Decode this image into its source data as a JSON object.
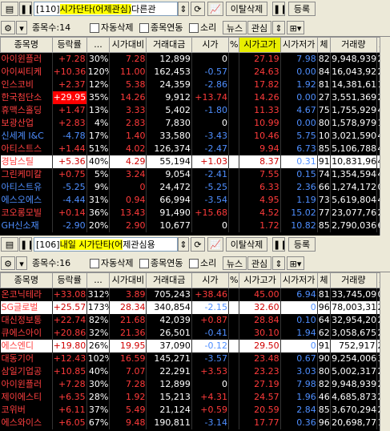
{
  "panel1": {
    "code": "[110]",
    "name_highlight": "시가단타(어제관심)",
    "name_rest": "다른관",
    "btn_remove": "이탈삭제",
    "btn_register": "등록",
    "count_label": "종목수:14",
    "chk_auto_delete": "자동삭제",
    "chk_stock_link": "종목연동",
    "chk_sound": "소리",
    "btn_news": "뉴스",
    "btn_interest": "관심",
    "headers": [
      "종목명",
      "등락률",
      "...",
      "시가대비",
      "거래대금",
      "시가",
      "%",
      "시가고가",
      "시가저가",
      "체",
      "거래량",
      "프"
    ],
    "rows": [
      [
        "아이윈플러",
        "+7.28",
        "30%",
        "7.28",
        "12,899",
        "0",
        "",
        "27.19",
        "7.98",
        "82",
        "9,948,939",
        "22"
      ],
      [
        "아이씨티케",
        "+10.36",
        "120%",
        "11.00",
        "162,453",
        "-0.57",
        "",
        "24.63",
        "0.00",
        "84",
        "16,043,928",
        "22"
      ],
      [
        "인스코비",
        "+2.37",
        "12%",
        "5.38",
        "24,359",
        "-2.86",
        "",
        "17.82",
        "1.92",
        "81",
        "14,381,613",
        "14"
      ],
      [
        "한국첨단소",
        "+29.95",
        "35%",
        "14.26",
        "9,912",
        "+13.74",
        "",
        "14.26",
        "0.00",
        "27",
        "3,551,369",
        "29"
      ],
      [
        "휴맥스홀딩",
        "+1.47",
        "13%",
        "3.33",
        "5,402",
        "-1.80",
        "",
        "11.33",
        "4.67",
        "75",
        "1,755,929",
        "49"
      ],
      [
        "보광산업",
        "+2.83",
        "4%",
        "2.83",
        "7,830",
        "0",
        "",
        "10.99",
        "0.00",
        "80",
        "1,578,979",
        "10"
      ],
      [
        "신세계 I&C",
        "-4.78",
        "17%",
        "1.40",
        "33,580",
        "-3.43",
        "",
        "10.46",
        "5.75",
        "101",
        "3,021,590",
        "46"
      ],
      [
        "아티스트스",
        "+1.44",
        "51%",
        "4.02",
        "126,374",
        "-2.47",
        "",
        "9.94",
        "6.73",
        "85",
        "5,106,788",
        "47"
      ],
      [
        "경남스틸",
        "+5.36",
        "40%",
        "4.29",
        "55,194",
        "+1.03",
        "",
        "8.37",
        "0.31",
        "91",
        "10,831,967",
        "49"
      ],
      [
        "그린케미칼",
        "+0.75",
        "5%",
        "3.24",
        "9,054",
        "-2.41",
        "",
        "7.55",
        "0.15",
        "74",
        "1,354,594",
        "44"
      ],
      [
        "아티스트유",
        "-5.25",
        "9%",
        "0",
        "24,472",
        "-5.25",
        "",
        "6.33",
        "2.36",
        "66",
        "1,274,172",
        "00"
      ],
      [
        "에스오에스",
        "-4.44",
        "31%",
        "0.94",
        "66,994",
        "-3.54",
        "",
        "4.95",
        "1.19",
        "73",
        "5,619,804",
        "45"
      ],
      [
        "코오롱모빌",
        "+0.14",
        "36%",
        "13.43",
        "91,490",
        "+15.68",
        "",
        "4.52",
        "15.02",
        "77",
        "23,077,767",
        "20"
      ],
      [
        "GH신소재",
        "-2.90",
        "20%",
        "2.90",
        "10,677",
        "0",
        "",
        "1.72",
        "10.82",
        "85",
        "2,790,036",
        "62"
      ]
    ]
  },
  "panel2": {
    "code": "[106]",
    "name_highlight": "내일 시가단타(어",
    "name_rest": "제관심용",
    "btn_remove": "이탈삭제",
    "btn_register": "등록",
    "count_label": "종목수:16",
    "chk_auto_delete": "자동삭제",
    "chk_stock_link": "종목연동",
    "chk_sound": "소리",
    "btn_news": "뉴스",
    "btn_interest": "관심",
    "headers": [
      "종목명",
      "등락률",
      "...",
      "시가대비",
      "거래대금",
      "시가",
      "%",
      "시가고가",
      "시가저가",
      "체",
      "거래량",
      "프"
    ],
    "rows": [
      [
        "온코닉테라",
        "+33.08",
        "312%",
        "3.89",
        "705,243",
        "+38.46",
        "",
        "45.00",
        "6.94",
        "81",
        "33,745,097",
        "00"
      ],
      [
        "SG글로벌",
        "+25.57",
        "173%",
        "28.34",
        "340,854",
        "-2.15",
        "",
        "32.60",
        "0",
        "96",
        "78,003,311",
        "26"
      ],
      [
        "대신정보통",
        "+22.74",
        "82%",
        "21.68",
        "42,039",
        "+0.87",
        "",
        "28.84",
        "0.10",
        "64",
        "32,954,204",
        "25"
      ],
      [
        "큐에스아이",
        "+20.86",
        "32%",
        "21.36",
        "26,501",
        "-0.41",
        "",
        "30.10",
        "1.94",
        "62",
        "3,058,675",
        "29"
      ],
      [
        "에스엔디",
        "+19.80",
        "26%",
        "19.95",
        "37,090",
        "-0.12",
        "",
        "29.50",
        "0",
        "91",
        "752,917",
        "29"
      ],
      [
        "대동기어",
        "+12.43",
        "102%",
        "16.59",
        "145,271",
        "-3.57",
        "",
        "23.48",
        "0.67",
        "90",
        "9,254,006",
        "39"
      ],
      [
        "삼일기업공",
        "+10.85",
        "40%",
        "7.07",
        "22,291",
        "+3.53",
        "",
        "23.23",
        "3.03",
        "80",
        "5,002,317",
        "27"
      ],
      [
        "아이윈플러",
        "+7.28",
        "30%",
        "7.28",
        "12,899",
        "0",
        "",
        "27.19",
        "7.98",
        "82",
        "9,948,939",
        "22"
      ],
      [
        "제이에스티",
        "+6.35",
        "28%",
        "1.92",
        "15,213",
        "+4.31",
        "",
        "24.57",
        "1.96",
        "46",
        "4,685,873",
        "29"
      ],
      [
        "코위버",
        "+6.11",
        "37%",
        "5.49",
        "21,124",
        "+0.59",
        "",
        "20.59",
        "2.84",
        "85",
        "3,670,294",
        "21"
      ],
      [
        "에스와이스",
        "+6.05",
        "67%",
        "9.48",
        "190,811",
        "-3.14",
        "",
        "17.77",
        "0.36",
        "96",
        "20,698,772",
        "14"
      ]
    ]
  }
}
